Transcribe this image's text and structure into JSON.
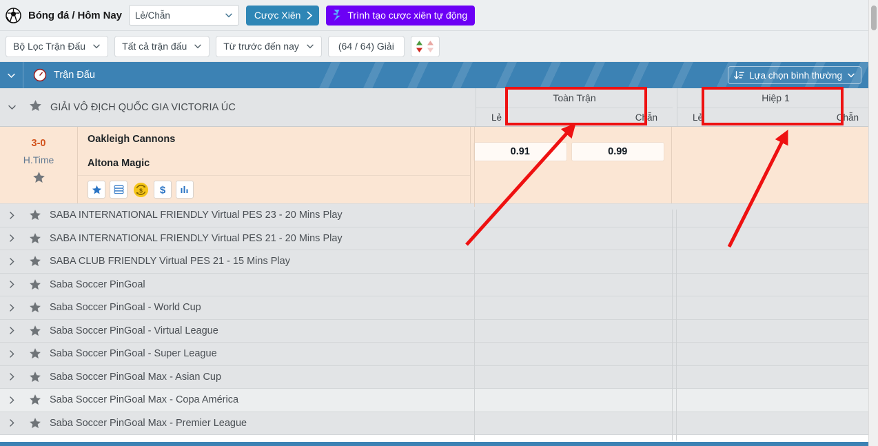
{
  "header": {
    "ball_icon": "soccer-ball-icon",
    "title": "Bóng đá / Hôm Nay",
    "market_select": {
      "value": "Lẻ/Chẵn",
      "placeholder": "Lẻ/Chẵn",
      "chevron": "chevron-down-icon"
    },
    "parlay_button": {
      "label": "Cược Xiên",
      "arrow": "chevron-right-icon",
      "color": "#2e86b6"
    },
    "auto_parlay_button": {
      "label": "Trình tạo cược xiên tự động",
      "icon": "lightning-bolt-icon",
      "color": "#6c00f5"
    }
  },
  "filters": {
    "match_filter": {
      "label": "Bộ Lọc Trận Đấu",
      "chevron": "chevron-down-icon"
    },
    "all_matches": {
      "label": "Tất cả trận đấu",
      "chevron": "chevron-down-icon"
    },
    "time_range": {
      "label": "Từ trước đến nay",
      "chevron": "chevron-down-icon"
    },
    "league_count": {
      "label": "(64 / 64) Giải"
    },
    "sort_toggle": {
      "name": "sort-toggle",
      "icon": "sort-updown-icon"
    }
  },
  "section_bar": {
    "collapse_chevron": "chevron-down-icon",
    "clock_icon": "clock-icon",
    "label": "Trận Đấu",
    "view_option": {
      "label": "Lựa chọn bình thường",
      "icon": "sort-descending-icon",
      "chevron": "chevron-down-icon"
    },
    "color": "#3c82b4"
  },
  "column_header": {
    "league_chevron": "chevron-down-icon",
    "league_star": "star-icon",
    "league_name": "GIẢI VÔ ĐỊCH QUỐC GIA VICTORIA ÚC",
    "groups": [
      {
        "title": "Toàn Trận",
        "left": "Lẻ",
        "right": "Chẵn",
        "highlighted": true
      },
      {
        "title": "Hiệp 1",
        "left": "Lẻ",
        "right": "Chẵn",
        "highlighted": true
      }
    ]
  },
  "match": {
    "score": "3-0",
    "period": "H.Time",
    "favorite_star": "star-icon",
    "home_team": "Oakleigh Cannons",
    "away_team": "Altona Magic",
    "action_icons": [
      {
        "name": "favorite-star-icon",
        "glyph": "star"
      },
      {
        "name": "stacked-layers-icon",
        "glyph": "layers"
      },
      {
        "name": "cashout-coin-icon",
        "glyph": "coin"
      },
      {
        "name": "dollar-icon",
        "glyph": "dollar"
      },
      {
        "name": "statistics-bars-icon",
        "glyph": "bars"
      }
    ],
    "odds_full_match": [
      {
        "label": "0.91"
      },
      {
        "label": "0.99"
      }
    ],
    "odds_first_half": [
      {
        "label": ""
      },
      {
        "label": ""
      }
    ]
  },
  "leagues": [
    {
      "label": "SABA INTERNATIONAL FRIENDLY Virtual PES 23 - 20 Mins Play"
    },
    {
      "label": "SABA INTERNATIONAL FRIENDLY Virtual PES 21 - 20 Mins Play"
    },
    {
      "label": "SABA CLUB FRIENDLY Virtual PES 21 - 15 Mins Play"
    },
    {
      "label": "Saba Soccer PinGoal"
    },
    {
      "label": "Saba Soccer PinGoal - World Cup"
    },
    {
      "label": "Saba Soccer PinGoal - Virtual League"
    },
    {
      "label": "Saba Soccer PinGoal - Super League"
    },
    {
      "label": "Saba Soccer PinGoal Max - Asian Cup"
    },
    {
      "label": "Saba Soccer PinGoal Max - Copa América"
    },
    {
      "label": "Saba Soccer PinGoal Max - Premier League"
    }
  ],
  "annotations": {
    "boxes": [
      {
        "name": "highlight-box-toan-tran"
      },
      {
        "name": "highlight-box-hiep-1"
      }
    ],
    "arrows": [
      {
        "name": "annotation-arrow-toan-tran"
      },
      {
        "name": "annotation-arrow-hiep-1"
      }
    ],
    "color": "#ee1111"
  },
  "scrollbars": {
    "vertical": "vertical-scrollbar",
    "horizontal": "horizontal-scrollbar"
  }
}
